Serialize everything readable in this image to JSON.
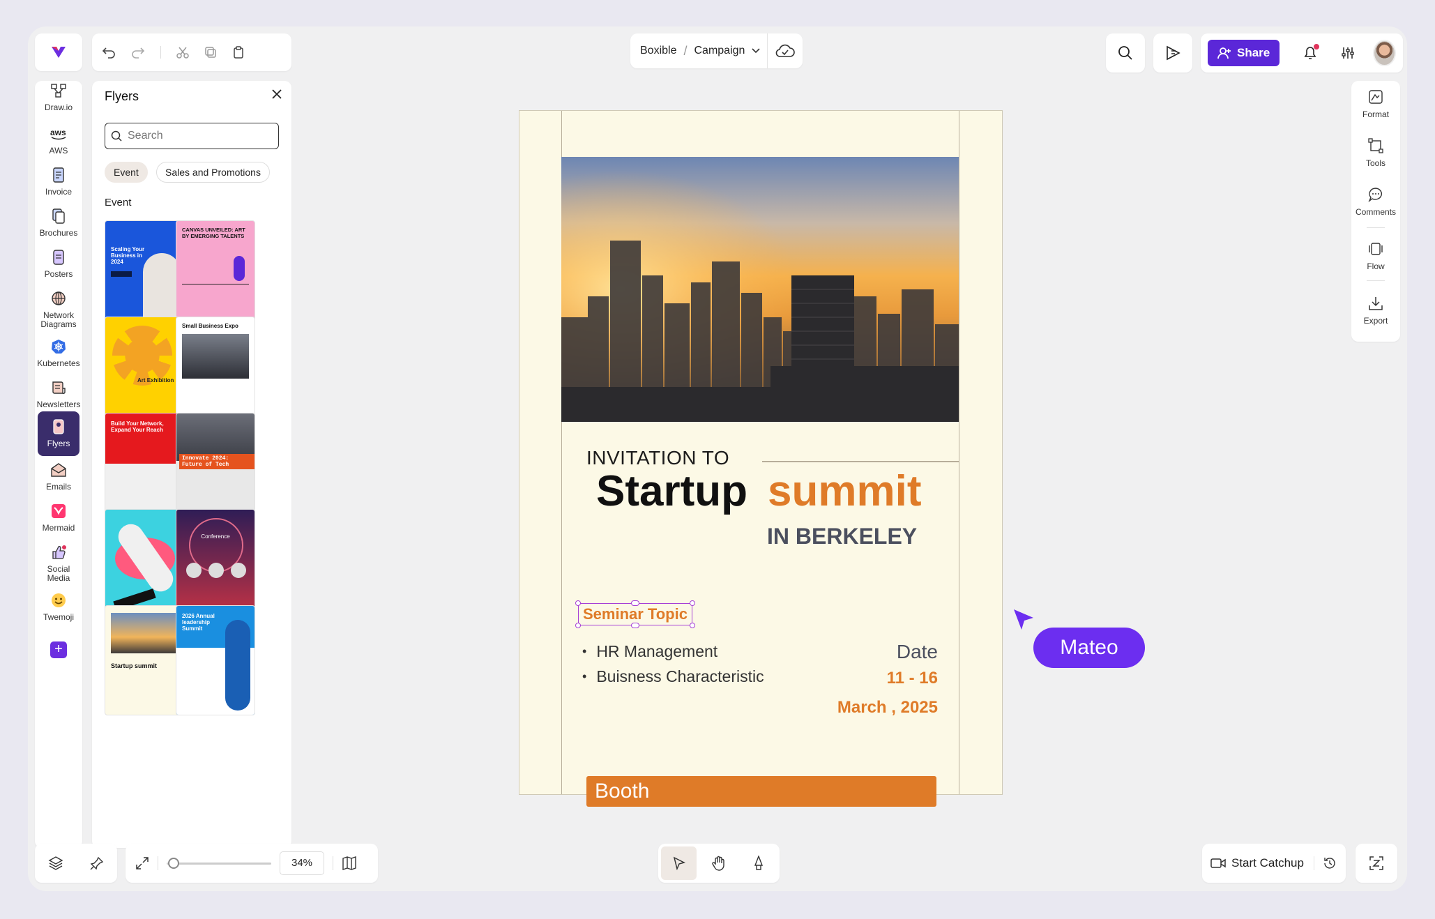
{
  "breadcrumb": {
    "workspace": "Boxible",
    "project": "Campaign"
  },
  "header": {
    "share_label": "Share"
  },
  "rail": {
    "items": [
      {
        "label": "Draw.io",
        "icon": "drawio-icon"
      },
      {
        "label": "AWS",
        "icon": "aws-icon"
      },
      {
        "label": "Invoice",
        "icon": "invoice-icon"
      },
      {
        "label": "Brochures",
        "icon": "brochures-icon"
      },
      {
        "label": "Posters",
        "icon": "posters-icon"
      },
      {
        "label": "Network Diagrams",
        "icon": "network-icon"
      },
      {
        "label": "Kubernetes",
        "icon": "kubernetes-icon"
      },
      {
        "label": "Newsletters",
        "icon": "newsletters-icon"
      },
      {
        "label": "Flyers",
        "icon": "flyers-icon",
        "active": true
      },
      {
        "label": "Emails",
        "icon": "emails-icon"
      },
      {
        "label": "Mermaid",
        "icon": "mermaid-icon"
      },
      {
        "label": "Social Media",
        "icon": "social-media-icon"
      },
      {
        "label": "Twemoji",
        "icon": "twemoji-icon"
      }
    ]
  },
  "panel": {
    "title": "Flyers",
    "search_placeholder": "Search",
    "chips": [
      "Event",
      "Sales and Promotions"
    ],
    "section": "Event",
    "thumbs": [
      {
        "text": "Scaling Your Business in 2024"
      },
      {
        "text": "CANVAS UNVEILED: ART BY EMERGING TALENTS"
      },
      {
        "text": "Art Exhibition"
      },
      {
        "text": "Small Business Expo"
      },
      {
        "text": "Build Your Network, Expand Your Reach"
      },
      {
        "text": "Innovate 2024: Future of Tech"
      },
      {
        "text": "Conference"
      },
      {
        "text": ""
      },
      {
        "text": "Startup summit"
      },
      {
        "text": "2026 Annual leadership Summit"
      }
    ]
  },
  "flyer": {
    "invite": "INVITATION TO",
    "title_a": "Startup",
    "title_b": "summit",
    "location": "IN BERKELEY",
    "topic": "Seminar Topic",
    "bullets": [
      "HR Management",
      "Buisness Characteristic"
    ],
    "date_label": "Date",
    "date_range": "11 - 16",
    "date_month": "March , 2025",
    "booth": "Booth"
  },
  "collaborator": {
    "name": "Mateo"
  },
  "right_rail": {
    "items": [
      {
        "label": "Format",
        "icon": "format-icon"
      },
      {
        "label": "Tools",
        "icon": "tools-icon"
      },
      {
        "label": "Comments",
        "icon": "comments-icon"
      },
      {
        "label": "Flow",
        "icon": "flow-icon"
      },
      {
        "label": "Export",
        "icon": "export-icon"
      }
    ]
  },
  "bottom": {
    "zoom": "34%",
    "catchup_label": "Start Catchup"
  },
  "colors": {
    "accent": "#5b27d8",
    "flyer_orange": "#df7b28",
    "flyer_bg": "#fcf9e6"
  }
}
